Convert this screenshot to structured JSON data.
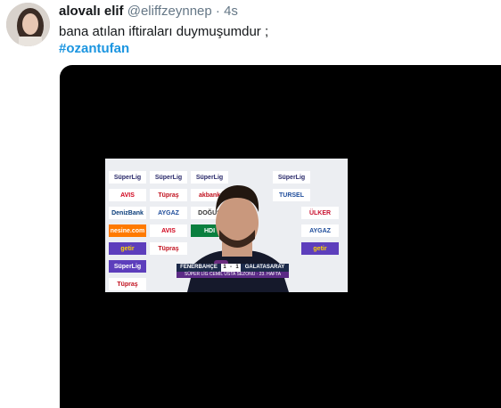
{
  "tweet": {
    "name": "alovalı elif",
    "handle": "@eliffzeynnep",
    "separator": "·",
    "time": "4s",
    "text": "bana atılan iftiraları duymuşumdur ;",
    "hashtag": "#ozantufan"
  },
  "video": {
    "sponsors": [
      "SüperLig",
      "SüperLig",
      "SüperLig",
      "SüperLig",
      "AVIS",
      "Tüpraş",
      "akbank",
      "TURSEL",
      "DenizBank",
      "AYGAZ",
      "DOĞUŞ",
      "ÜLKER",
      "nesine.com",
      "AVIS",
      "HDI",
      "AYGAZ",
      "getir",
      "Tüpraş",
      "getir",
      "SüperLig",
      "Tüpraş"
    ],
    "scoreboard": {
      "home": "FENERBAHÇE",
      "home_score": "1",
      "separator": "-",
      "away_score": "1",
      "away": "GALATASARAY",
      "subtitle": "SÜPER LİG CEMİL USTA SEZONU · 23. HAFTA"
    }
  }
}
